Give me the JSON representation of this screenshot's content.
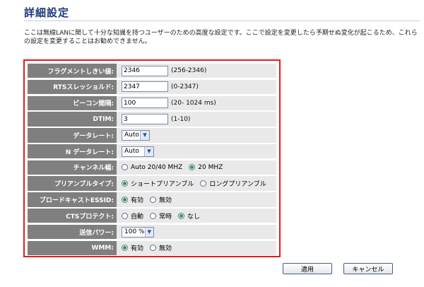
{
  "page": {
    "title": "詳細設定",
    "description": "ここは無線LANに関して十分な知識を持つユーザーのための高度な設定です。ここで設定を変更したら予期せぬ変化が起こるため、これらの設定を変更することはお勧めできません。"
  },
  "settings": {
    "fragment": {
      "label": "フラグメントしきい値:",
      "value": "2346",
      "hint": "(256-2346)"
    },
    "rts": {
      "label": "RTSスレッショルド:",
      "value": "2347",
      "hint": "(0-2347)"
    },
    "beacon": {
      "label": "ビーコン間隔:",
      "value": "100",
      "hint": "(20- 1024 ms)"
    },
    "dtim": {
      "label": "DTIM:",
      "value": "3",
      "hint": "(1-10)"
    },
    "datarate": {
      "label": "データレート:",
      "selected": "Auto"
    },
    "ndatarate": {
      "label": "N データレート:",
      "selected": "Auto"
    },
    "channelwidth": {
      "label": "チャンネル幅:",
      "options": [
        "Auto 20/40 MHZ",
        "20 MHZ"
      ],
      "selected": "20 MHZ"
    },
    "preamble": {
      "label": "プリアンブルタイプ:",
      "options": [
        "ショートプリアンブル",
        "ロングプリアンブル"
      ],
      "selected": "ショートプリアンブル"
    },
    "broadcast": {
      "label": "ブロードキャストESSID:",
      "options": [
        "有効",
        "無効"
      ],
      "selected": "有効"
    },
    "cts": {
      "label": "CTSプロテクト:",
      "options": [
        "自動",
        "常時",
        "なし"
      ],
      "selected": "なし"
    },
    "txpower": {
      "label": "送信パワー:",
      "selected": "100 %"
    },
    "wmm": {
      "label": "WMM:",
      "options": [
        "有効",
        "無効"
      ],
      "selected": "有効"
    }
  },
  "buttons": {
    "apply": "適用",
    "cancel": "キャンセル"
  },
  "colors": {
    "frame": "#e21b1b",
    "label_bg": "#7f7f7f",
    "value_bg": "#e9e9e9",
    "title": "#1f3a78"
  }
}
